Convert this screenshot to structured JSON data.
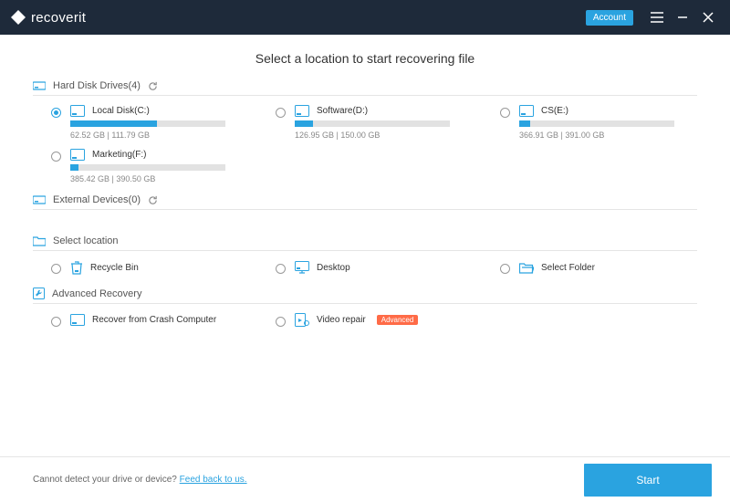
{
  "app": {
    "name": "recoverit"
  },
  "titlebar": {
    "account_label": "Account"
  },
  "main": {
    "title": "Select a location to start recovering file",
    "sections": {
      "drives": {
        "label": "Hard Disk Drives(4)",
        "items": [
          {
            "name": "Local Disk(C:)",
            "used": 62.52,
            "total": 111.79,
            "size_text": "62.52  GB | 111.79  GB",
            "selected": true
          },
          {
            "name": "Software(D:)",
            "used": 126.95,
            "total": 150.0,
            "size_text": "126.95  GB | 150.00  GB",
            "selected": false
          },
          {
            "name": "CS(E:)",
            "used": 366.91,
            "total": 391.0,
            "size_text": "366.91  GB | 391.00  GB",
            "selected": false
          },
          {
            "name": "Marketing(F:)",
            "used": 385.42,
            "total": 390.5,
            "size_text": "385.42  GB | 390.50  GB",
            "selected": false
          }
        ]
      },
      "external": {
        "label": "External Devices(0)"
      },
      "select_location": {
        "label": "Select location",
        "items": [
          {
            "name": "Recycle Bin"
          },
          {
            "name": "Desktop"
          },
          {
            "name": "Select Folder"
          }
        ]
      },
      "advanced": {
        "label": "Advanced Recovery",
        "items": [
          {
            "name": "Recover from Crash Computer",
            "badge": null
          },
          {
            "name": "Video repair",
            "badge": "Advanced"
          }
        ]
      }
    }
  },
  "footer": {
    "prompt": "Cannot detect your drive or device? ",
    "link": "Feed back to us.",
    "start_label": "Start"
  },
  "colors": {
    "accent": "#2aa3e0",
    "header_bg": "#1e2a3a",
    "badge": "#ff6b47"
  }
}
